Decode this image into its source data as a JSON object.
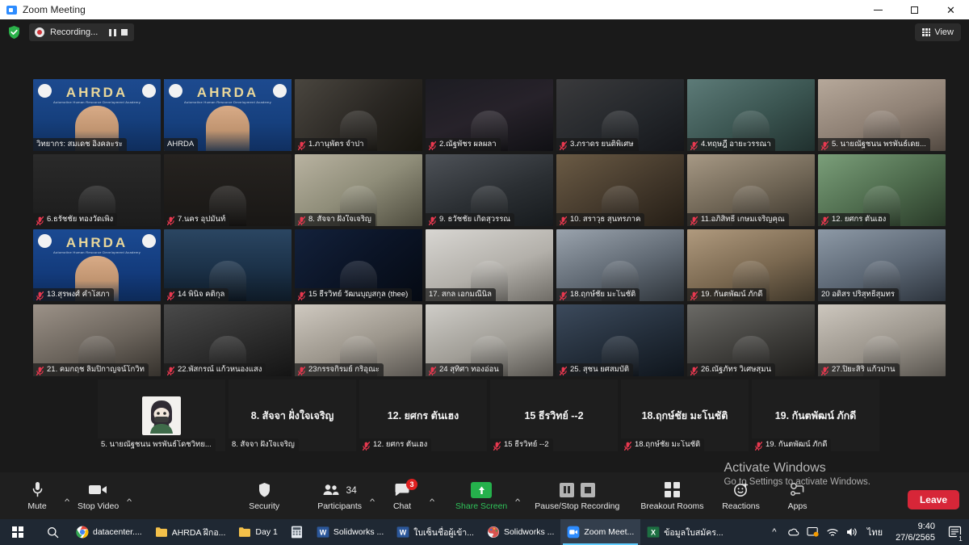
{
  "window": {
    "title": "Zoom Meeting",
    "app_icon": "zoom-camera-icon",
    "minimize": "–",
    "maximize": "❐",
    "close": "✕"
  },
  "topbar": {
    "shield_icon": "encryption-shield-icon",
    "recording_label": "Recording...",
    "record_dot_icon": "record-dot-icon",
    "pause_icon": "pause-icon",
    "stop_icon": "stop-icon",
    "view_label": "View",
    "view_icon": "grid-view-icon"
  },
  "gallery": {
    "mic_muted_icon": "microphone-muted-icon",
    "rows": [
      {
        "tiles": [
          {
            "name": "วิทยากร: สมเดช อิงคละระ",
            "muted": false,
            "speaking": false,
            "kind": "video",
            "bg": "ahrda"
          },
          {
            "name": "AHRDA",
            "muted": false,
            "speaking": true,
            "kind": "video",
            "bg": "ahrda2"
          },
          {
            "name": "1.ภานุพัตร  จำปา",
            "muted": true,
            "speaking": false,
            "kind": "video",
            "bg": "dark-room"
          },
          {
            "name": "2.ณัฐพัชร ผลผลา",
            "muted": true,
            "speaking": false,
            "kind": "video",
            "bg": "dark-person"
          },
          {
            "name": "3.ภราดร ยนติพิเศษ",
            "muted": true,
            "speaking": false,
            "kind": "video",
            "bg": "mask-person"
          },
          {
            "name": "4.ทฤษฎี์ อายะวรรณา",
            "muted": true,
            "speaking": false,
            "kind": "video",
            "bg": "teal-mask"
          },
          {
            "name": "5. นายณัฐชนน พรพันธ์เดย...",
            "muted": true,
            "speaking": false,
            "kind": "video",
            "bg": "light-room"
          }
        ]
      },
      {
        "tiles": [
          {
            "name": "6.ธรัชชัย ทองวัดเพิง",
            "muted": true,
            "speaking": false,
            "kind": "video",
            "bg": "portrait-narrow"
          },
          {
            "name": "7.นคร อุปมันท์",
            "muted": true,
            "speaking": false,
            "kind": "video",
            "bg": "portrait-narrow2"
          },
          {
            "name": "8. สัจจา ฝั่งใจเจริญ",
            "muted": true,
            "speaking": false,
            "kind": "video",
            "bg": "yellow-shirt"
          },
          {
            "name": "9. ธวัชชัย เกิดสุวรรณ",
            "muted": true,
            "speaking": false,
            "kind": "video",
            "bg": "dim-room"
          },
          {
            "name": "10. สราวุธ สุนทรภาค",
            "muted": true,
            "speaking": false,
            "kind": "video",
            "bg": "wood-room"
          },
          {
            "name": "11.อภิสิทธิ์   เกษมเจริญคุณ",
            "muted": true,
            "speaking": false,
            "kind": "video",
            "bg": "indoor-man"
          },
          {
            "name": "12. ยศกร ตันเฮง",
            "muted": true,
            "speaking": false,
            "kind": "video",
            "bg": "green-bg"
          }
        ]
      },
      {
        "tiles": [
          {
            "name": "13.สุรพงศ์ คำโสภา",
            "muted": true,
            "speaking": false,
            "kind": "video",
            "bg": "ahrda3"
          },
          {
            "name": "14 พินิจ คติกุล",
            "muted": true,
            "speaking": false,
            "kind": "video",
            "bg": "bridge-night"
          },
          {
            "name": "15 ธีรวิทย์ วัฒนบุญสกุล (thee)",
            "muted": true,
            "speaking": false,
            "kind": "video",
            "bg": "space-bg"
          },
          {
            "name": "17. สกล เอกมณีนิล",
            "muted": false,
            "speaking": false,
            "kind": "video",
            "bg": "white-room"
          },
          {
            "name": "18.ฤกษ์ชัย มะโนชัติ",
            "muted": true,
            "speaking": false,
            "kind": "video",
            "bg": "mask-blue"
          },
          {
            "name": "19. กันตพัฒน์ ภักดี",
            "muted": true,
            "speaking": false,
            "kind": "video",
            "bg": "warm-room"
          },
          {
            "name": "20 อดิสร ปริสุทธิ์สุมทร",
            "muted": false,
            "speaking": false,
            "kind": "video",
            "bg": "glasses-man"
          }
        ]
      },
      {
        "tiles": [
          {
            "name": "21. คมกฤช ลิมปิกาญจน์โกวิท",
            "muted": true,
            "speaking": false,
            "kind": "video",
            "bg": "office-man"
          },
          {
            "name": "22.พัสกรณ์ แก้วหนองแสง",
            "muted": true,
            "speaking": false,
            "kind": "video",
            "bg": "mask-dark"
          },
          {
            "name": "23กรรจกิรมย์ กริอุณะ",
            "muted": true,
            "speaking": false,
            "kind": "video",
            "bg": "bright-room"
          },
          {
            "name": "24 สุทิศา ทองอ่อน",
            "muted": true,
            "speaking": false,
            "kind": "video",
            "bg": "mask-white"
          },
          {
            "name": "25. สุชน ยศสมบัติ",
            "muted": true,
            "speaking": false,
            "kind": "video",
            "bg": "dark-blue"
          },
          {
            "name": "26.ณัฐภัทร วิเศษสุมน",
            "muted": true,
            "speaking": false,
            "kind": "video",
            "bg": "glasses-dark"
          },
          {
            "name": "27.ปิยะสิริ แก้วปาน",
            "muted": true,
            "speaking": false,
            "kind": "video",
            "bg": "mask-light"
          }
        ]
      },
      {
        "tiles": [
          {
            "name": "5. นายณัฐชนน พรพันธ์โดชวิทย...",
            "muted": false,
            "speaking": false,
            "kind": "avatar",
            "big": ""
          },
          {
            "name": "8. สัจจา ฝั่งใจเจริญ",
            "muted": false,
            "speaking": false,
            "kind": "text",
            "big": "8. สัจจา ฝั่งใจเจริญ"
          },
          {
            "name": "12. ยศกร ตันเฮง",
            "muted": true,
            "speaking": false,
            "kind": "text",
            "big": "12. ยศกร ตันเฮง"
          },
          {
            "name": "15 ธีรวิทย์ --2",
            "muted": true,
            "speaking": false,
            "kind": "text",
            "big": "15 ธีรวิทย์ --2"
          },
          {
            "name": "18.ฤกษ์ชัย มะโนชัติ",
            "muted": true,
            "speaking": false,
            "kind": "text",
            "big": "18.ฤกษ์ชัย มะโนชัติ"
          },
          {
            "name": "19. กันตพัฒน์ ภักดี",
            "muted": true,
            "speaking": false,
            "kind": "text",
            "big": "19. กันตพัฒน์ ภักดี"
          }
        ]
      }
    ]
  },
  "toolbar": {
    "mute_label": "Mute",
    "mute_icon": "microphone-icon",
    "video_label": "Stop Video",
    "video_icon": "video-camera-icon",
    "security_label": "Security",
    "security_icon": "shield-icon",
    "participants_label": "Participants",
    "participants_icon": "people-icon",
    "participants_count": "34",
    "chat_label": "Chat",
    "chat_icon": "chat-bubble-icon",
    "chat_badge": "3",
    "share_label": "Share Screen",
    "share_icon": "share-up-arrow-icon",
    "recording_label": "Pause/Stop Recording",
    "recording_pause_icon": "pause-icon",
    "recording_stop_icon": "stop-icon",
    "breakout_label": "Breakout Rooms",
    "breakout_icon": "four-squares-icon",
    "reactions_label": "Reactions",
    "reactions_icon": "smiley-plus-icon",
    "apps_label": "Apps",
    "apps_icon": "apps-icon",
    "leave_label": "Leave",
    "caret_icon": "chevron-up-icon"
  },
  "watermark": {
    "line1": "Activate Windows",
    "line2": "Go to Settings to activate Windows."
  },
  "taskbar": {
    "start_icon": "windows-start-icon",
    "search_icon": "search-icon",
    "items": [
      {
        "label": "datacenter....",
        "icon": "chrome-icon",
        "active": false,
        "color": "#f0f0f0"
      },
      {
        "label": "AHRDA ฝึกอ...",
        "icon": "folder-icon",
        "active": false,
        "color": "#f7c145"
      },
      {
        "label": "Day 1",
        "icon": "folder-icon",
        "active": false,
        "color": "#f7c145"
      },
      {
        "label": "",
        "icon": "calculator-icon",
        "active": false,
        "color": "#cfd8e3"
      },
      {
        "label": "Solidworks ...",
        "icon": "word-icon",
        "active": false,
        "color": "#2b579a"
      },
      {
        "label": "ใบเซ็นชื่อผู้เข้า...",
        "icon": "word-icon",
        "active": false,
        "color": "#2b579a"
      },
      {
        "label": "Solidworks ...",
        "icon": "paint-icon",
        "active": false,
        "color": "#d9534f"
      },
      {
        "label": "Zoom Meet...",
        "icon": "zoom-icon",
        "active": true,
        "color": "#2d8cff"
      },
      {
        "label": "ข้อมูลใบสมัคร...",
        "icon": "excel-icon",
        "active": false,
        "color": "#1d6f42"
      }
    ],
    "tray": {
      "chevron_icon": "chevron-up-icon",
      "onedrive_icon": "onedrive-icon",
      "display_icon": "display-icon",
      "wifi_icon": "wifi-icon",
      "volume_icon": "volume-icon",
      "language": "ไทย",
      "time": "9:40",
      "date": "27/6/2565",
      "notification_icon": "notification-icon",
      "notification_count": "1"
    }
  }
}
